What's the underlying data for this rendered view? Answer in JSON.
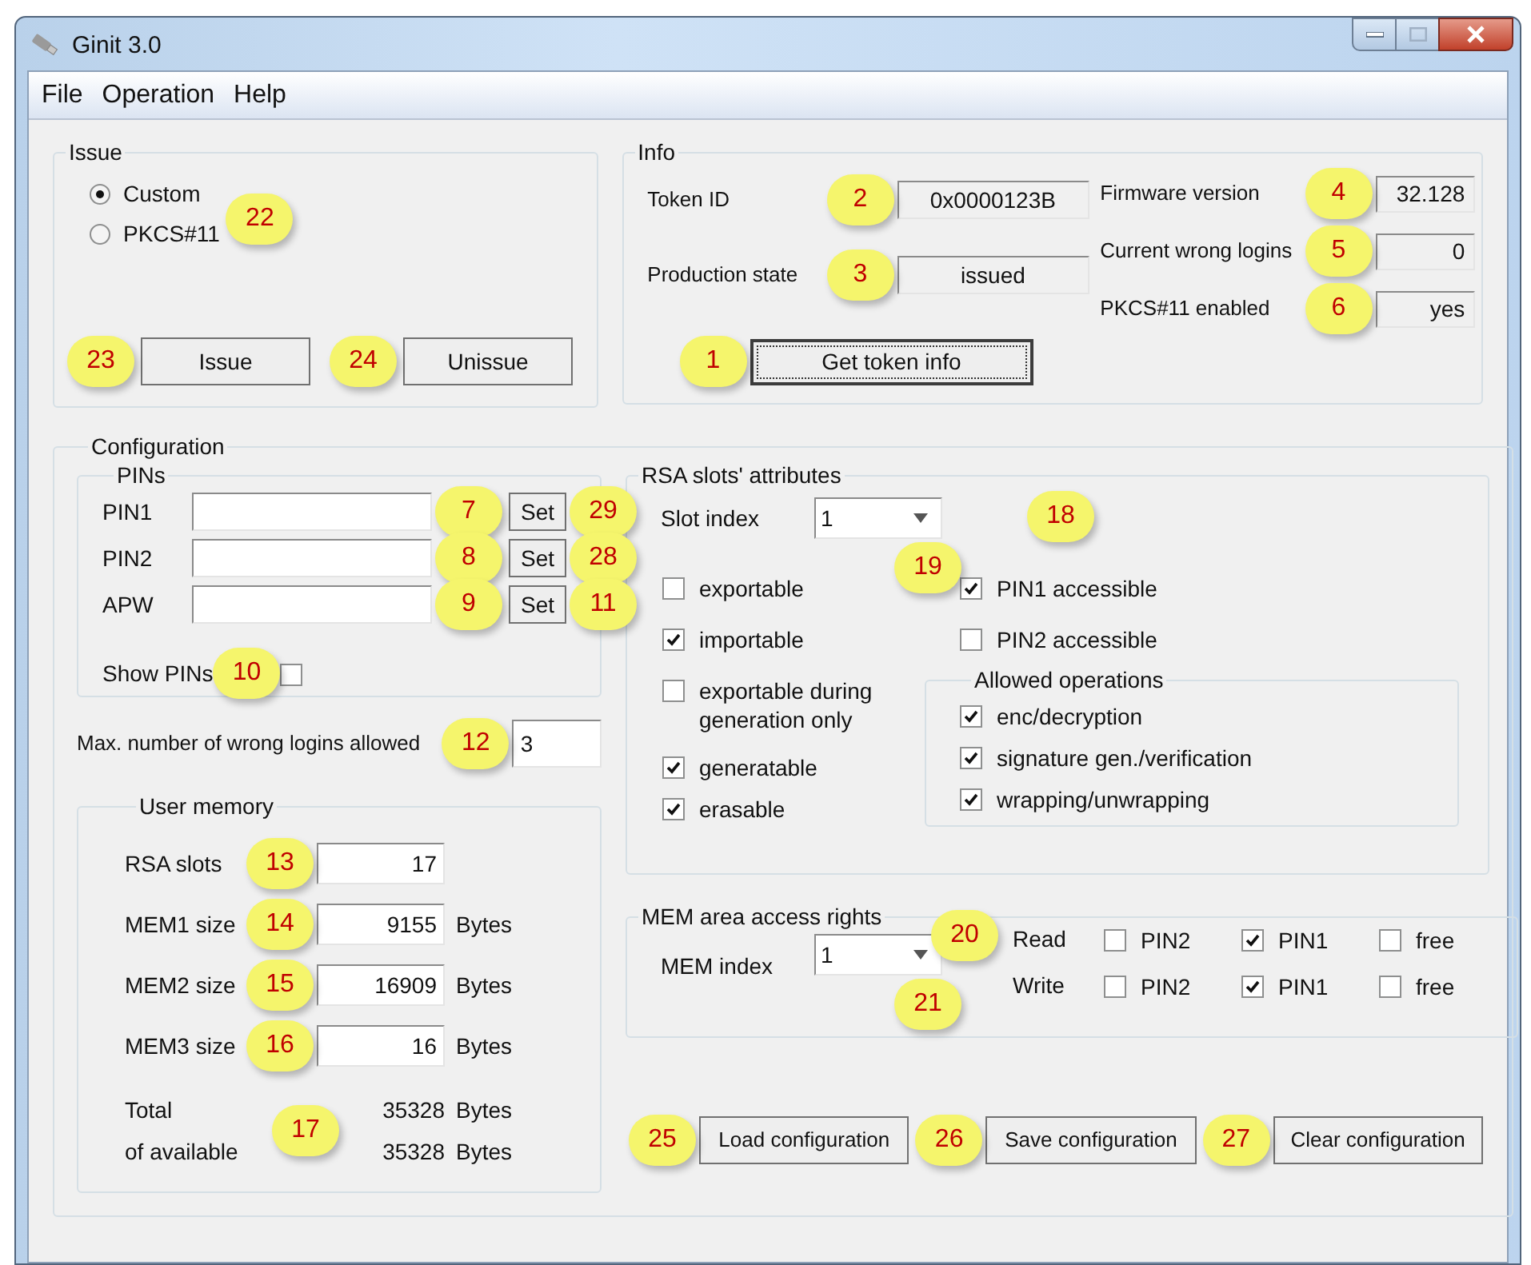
{
  "window": {
    "title": "Ginit 3.0"
  },
  "menu": [
    {
      "label": "File"
    },
    {
      "label": "Operation"
    },
    {
      "label": "Help"
    }
  ],
  "issue": {
    "title": "Issue",
    "callout": "22",
    "options": [
      {
        "label": "Custom",
        "selected": true
      },
      {
        "label": "PKCS#11",
        "selected": false
      }
    ],
    "buttons": [
      {
        "label": "Issue",
        "callout": "23"
      },
      {
        "label": "Unissue",
        "callout": "24"
      }
    ]
  },
  "info": {
    "title": "Info",
    "left_fields": [
      {
        "label": "Token ID",
        "value": "0x0000123B",
        "callout": "2"
      },
      {
        "label": "Production state",
        "value": "issued",
        "callout": "3"
      }
    ],
    "right_fields": [
      {
        "label": "Firmware version",
        "value": "32.128",
        "callout": "4"
      },
      {
        "label": "Current wrong logins",
        "value": "0",
        "callout": "5"
      },
      {
        "label": "PKCS#11 enabled",
        "value": "yes",
        "callout": "6"
      }
    ],
    "button": {
      "label": "Get token info",
      "callout": "1"
    }
  },
  "configuration": {
    "title": "Configuration",
    "pins": {
      "title": "PINs",
      "rows": [
        {
          "label": "PIN1",
          "callout": "7",
          "button": "Set",
          "button_callout": "29"
        },
        {
          "label": "PIN2",
          "callout": "8",
          "button": "Set",
          "button_callout": "28"
        },
        {
          "label": "APW",
          "callout": "9",
          "button": "Set",
          "button_callout": "11"
        }
      ],
      "show_pins": {
        "label": "Show PINs",
        "checked": false,
        "callout": "10"
      }
    },
    "max_logins": {
      "label": "Max. number of wrong logins allowed",
      "value": "3",
      "callout": "12"
    },
    "user_memory": {
      "title": "User memory",
      "rows": [
        {
          "label": "RSA slots",
          "value": "17",
          "callout": "13"
        },
        {
          "label": "MEM1 size",
          "value": "9155",
          "unit": "Bytes",
          "callout": "14"
        },
        {
          "label": "MEM2 size",
          "value": "16909",
          "unit": "Bytes",
          "callout": "15"
        },
        {
          "label": "MEM3 size",
          "value": "16",
          "unit": "Bytes",
          "callout": "16"
        }
      ],
      "totals": {
        "callout": "17",
        "rows": [
          {
            "label": "Total",
            "value": "35328",
            "unit": "Bytes"
          },
          {
            "label": "of available",
            "value": "35328",
            "unit": "Bytes"
          }
        ]
      }
    },
    "rsa_attributes": {
      "title": "RSA slots' attributes",
      "callout": "18",
      "slot_index": {
        "label": "Slot index",
        "value": "1",
        "callout": "19"
      },
      "left_checks": [
        {
          "label": "exportable",
          "checked": false
        },
        {
          "label": "importable",
          "checked": true
        },
        {
          "label": "exportable during generation only",
          "checked": false
        },
        {
          "label": "generatable",
          "checked": true
        },
        {
          "label": "erasable",
          "checked": true
        }
      ],
      "right_checks": [
        {
          "label": "PIN1 accessible",
          "checked": true
        },
        {
          "label": "PIN2 accessible",
          "checked": false
        }
      ],
      "allowed_operations": {
        "title": "Allowed operations",
        "checks": [
          {
            "label": "enc/decryption",
            "checked": true
          },
          {
            "label": "signature gen./verification",
            "checked": true
          },
          {
            "label": "wrapping/unwrapping",
            "checked": true
          }
        ]
      }
    },
    "mem_rights": {
      "title": "MEM area access rights",
      "callout": "20",
      "mem_index": {
        "label": "MEM index",
        "value": "1",
        "callout": "21"
      },
      "rows": [
        {
          "label": "Read",
          "options": [
            {
              "label": "PIN2",
              "checked": false
            },
            {
              "label": "PIN1",
              "checked": true
            },
            {
              "label": "free",
              "checked": false
            }
          ]
        },
        {
          "label": "Write",
          "options": [
            {
              "label": "PIN2",
              "checked": false
            },
            {
              "label": "PIN1",
              "checked": true
            },
            {
              "label": "free",
              "checked": false
            }
          ]
        }
      ]
    },
    "buttons": [
      {
        "label": "Load configuration",
        "callout": "25"
      },
      {
        "label": "Save configuration",
        "callout": "26"
      },
      {
        "label": "Clear configuration",
        "callout": "27"
      }
    ]
  }
}
